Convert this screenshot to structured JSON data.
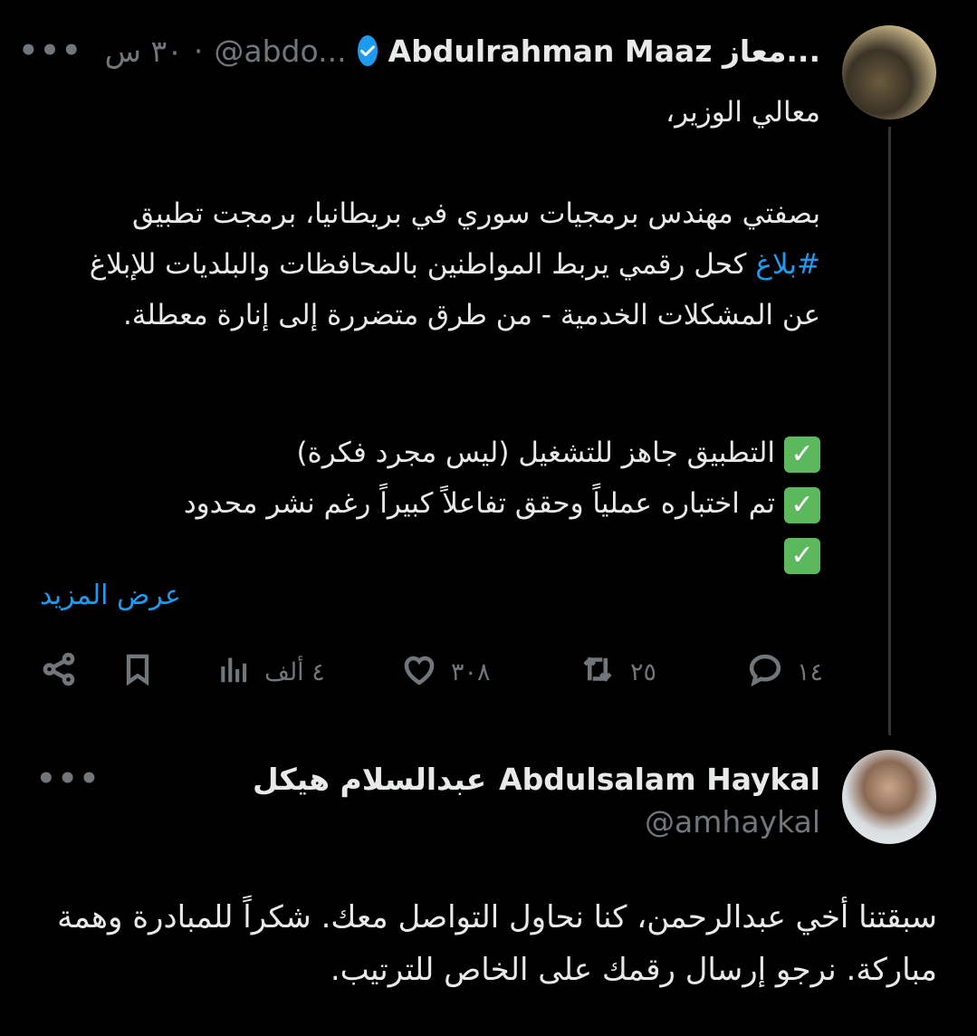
{
  "tweet1": {
    "display_name": "Abdulrahman Maaz معاز...",
    "handle": "@abdo...",
    "separator": "·",
    "time": "٣٠ س",
    "more": "•••",
    "body_intro": "معالي الوزير،",
    "body_para_pre": "بصفتي مهندس برمجيات سوري في بريطانيا، برمجت تطبيق ",
    "hashtag": "#بلاغ",
    "body_para_post": " كحل رقمي يربط المواطنين بالمحافظات والبلديات للإبلاغ عن المشكلات الخدمية - من طرق متضررة إلى إنارة معطلة.",
    "check_items": [
      "التطبيق جاهز للتشغيل (ليس مجرد فكرة)",
      "تم اختباره عملياً وحقق تفاعلاً كبيراً رغم نشر محدود",
      ""
    ],
    "check_glyph": "✓",
    "show_more": "عرض المزيد",
    "stats": {
      "replies": "١٤",
      "reposts": "٢٥",
      "likes": "٣٠٨",
      "views": "٤ ألف"
    }
  },
  "tweet2": {
    "display_name_en": "Abdulsalam Haykal",
    "display_name_ar": "عبدالسلام هيكل",
    "handle": "@amhaykal",
    "more": "•••",
    "body": "سبقتنا أخي عبدالرحمن، كنا نحاول التواصل معك. شكراً للمبادرة وهمة مباركة. نرجو إرسال رقمك على الخاص للترتيب."
  },
  "icons": [
    "reply-icon",
    "repost-icon",
    "like-icon",
    "views-icon",
    "bookmark-icon",
    "share-icon",
    "verified-badge-icon"
  ],
  "colors": {
    "background": "#000000",
    "text": "#e7e9ea",
    "muted": "#71767b",
    "accent": "#1d9bf0",
    "check": "#5cb85c"
  }
}
